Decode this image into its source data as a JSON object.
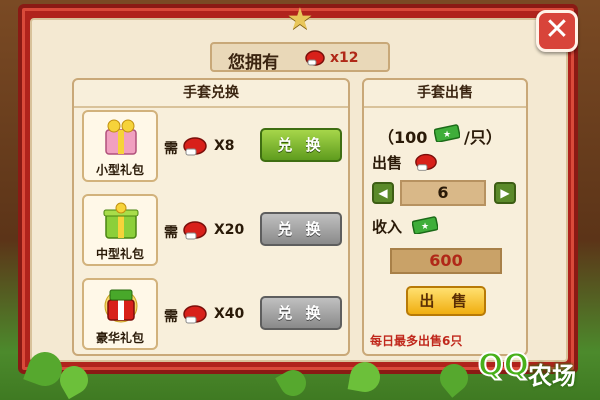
{
  "header": {
    "owned_label": "您拥有",
    "owned_count": "x12",
    "glove_icon": "glove-icon"
  },
  "exchange_panel": {
    "title": "手套兑换",
    "need_label": "需",
    "items": [
      {
        "label": "小型礼包",
        "count": "X8",
        "button": "兑 换",
        "enabled": true
      },
      {
        "label": "中型礼包",
        "count": "X20",
        "button": "兑 换",
        "enabled": false
      },
      {
        "label": "豪华礼包",
        "count": "X40",
        "button": "兑 换",
        "enabled": false
      }
    ]
  },
  "sell_panel": {
    "title": "手套出售",
    "price_prefix": "（100",
    "price_suffix": "/只）",
    "sell_label": "出售",
    "quantity": "6",
    "income_label": "收入",
    "income_value": "600",
    "sell_button": "出 售",
    "daily_limit": "每日最多出售6只"
  },
  "logo": {
    "qq": "QQ",
    "text": "农场"
  },
  "colors": {
    "frame": "#b0231c",
    "green_button": "#5f9c1e",
    "gray_button": "#8a8a8a",
    "sell_button": "#f0ae10"
  }
}
